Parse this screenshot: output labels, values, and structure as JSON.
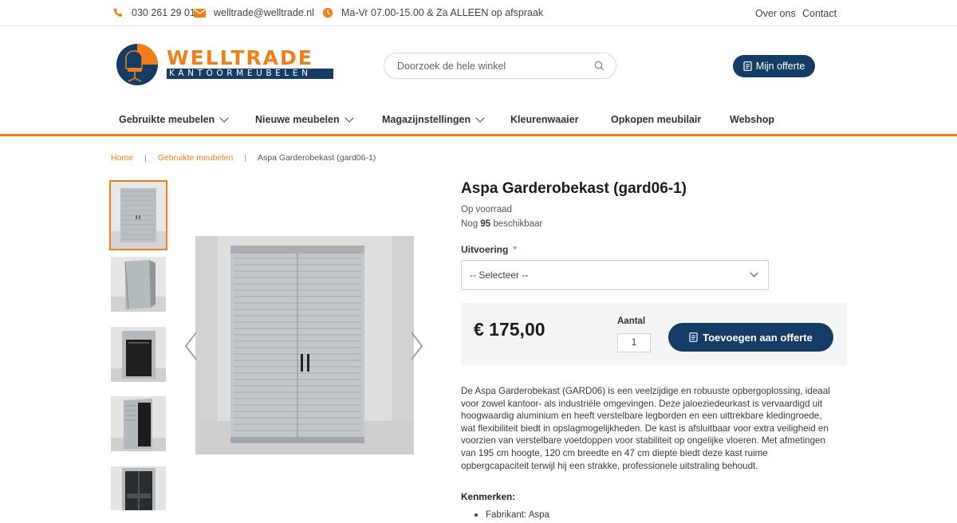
{
  "topbar": {
    "phone": "030 261 29 01",
    "email": "welltrade@welltrade.nl",
    "hours": "Ma-Vr 07.00-15.00 & Za ALLEEN op afspraak",
    "links": [
      "Over ons",
      "Contact"
    ]
  },
  "header": {
    "logo_text_top": "WELLTRADE",
    "logo_text_bottom": "KANTOORMEUBELEN",
    "search_placeholder": "Doorzoek de hele winkel",
    "offerte_label": "Mijn offerte"
  },
  "nav": {
    "items": [
      {
        "label": "Gebruikte meubelen",
        "has_dropdown": true
      },
      {
        "label": "Nieuwe meubelen",
        "has_dropdown": true
      },
      {
        "label": "Magazijnstellingen",
        "has_dropdown": true
      },
      {
        "label": "Kleurenwaaier",
        "has_dropdown": false
      },
      {
        "label": "Opkopen meubilair",
        "has_dropdown": false
      },
      {
        "label": "Webshop",
        "has_dropdown": false
      }
    ]
  },
  "breadcrumb": {
    "items": [
      "Home",
      "Gebruikte meubelen",
      "Aspa Garderobekast (gard06-1)"
    ]
  },
  "product": {
    "title": "Aspa Garderobekast (gard06-1)",
    "stock_status": "Op voorraad",
    "avail_prefix": "Nog",
    "avail_count": "95",
    "avail_suffix": "beschikbaar",
    "variant_label": "Uitvoering",
    "variant_required": "*",
    "variant_selected": "-- Selecteer --",
    "price": "€ 175,00",
    "qty_label": "Aantal",
    "qty_value": "1",
    "add_label": "Toevoegen aan offerte",
    "description": "De Aspa Garderobekast (GARD06) is een veelzijdige en robuuste opbergoplossing, ideaal voor zowel kantoor- als industriële omgevingen. Deze jaloeziedeurkast is vervaardigd uit hoogwaardig aluminium en heeft verstelbare legborden en een uittrekbare kledingroede, wat flexibiliteit biedt in opslagmogelijkheden. De kast is afsluitbaar voor extra veiligheid en voorzien van verstelbare voetdoppen voor stabiliteit op ongelijke vloeren. Met afmetingen van 195 cm hoogte, 120 cm breedte en 47 cm diepte biedt deze kast ruime opbergcapaciteit terwijl hij een strakke, professionele uitstraling behoudt.",
    "features_title": "Kenmerken:",
    "features": [
      "Fabrikant: Aspa"
    ]
  },
  "gallery": {
    "thumb_count": 5,
    "active_index": 0
  },
  "colors": {
    "accent": "#f07f17",
    "brand_navy": "#143c66"
  }
}
